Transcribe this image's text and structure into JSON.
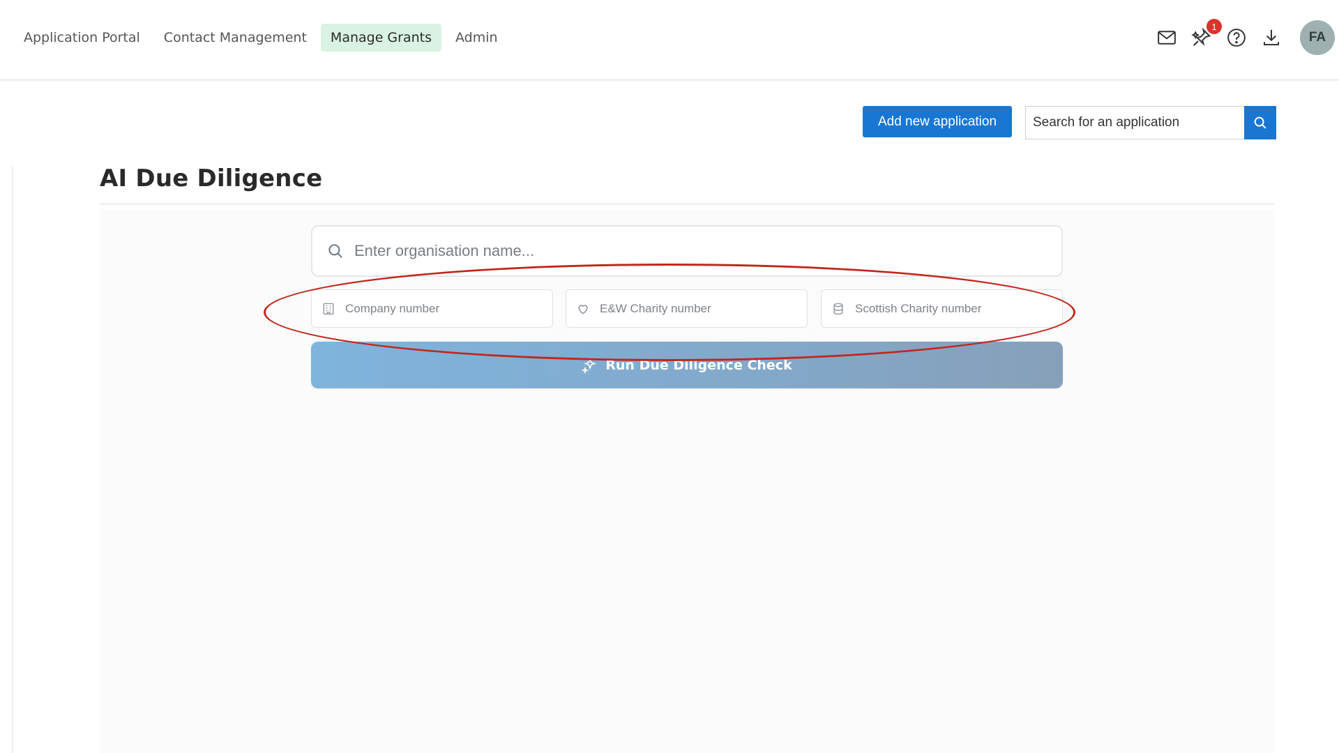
{
  "nav": {
    "items": [
      {
        "label": "Application Portal",
        "active": false
      },
      {
        "label": "Contact Management",
        "active": false
      },
      {
        "label": "Manage Grants",
        "active": true
      },
      {
        "label": "Admin",
        "active": false
      }
    ]
  },
  "header_icons": {
    "mail": "envelope-icon",
    "notifications": "sparkle-pin-icon",
    "notification_count": "1",
    "help": "question-icon",
    "download": "download-icon"
  },
  "user": {
    "initials": "FA"
  },
  "actions": {
    "add_label": "Add new application",
    "search_placeholder": "Search for an application"
  },
  "page": {
    "title": "AI Due Diligence"
  },
  "form": {
    "org_placeholder": "Enter organisation name...",
    "company_placeholder": "Company number",
    "ew_charity_placeholder": "E&W Charity number",
    "scottish_charity_placeholder": "Scottish Charity number",
    "run_label": "Run Due Diligence Check"
  },
  "colors": {
    "primary": "#1976d2",
    "active_tab": "#d9f2e3",
    "badge": "#d9342b",
    "annotation": "#c0271d"
  }
}
